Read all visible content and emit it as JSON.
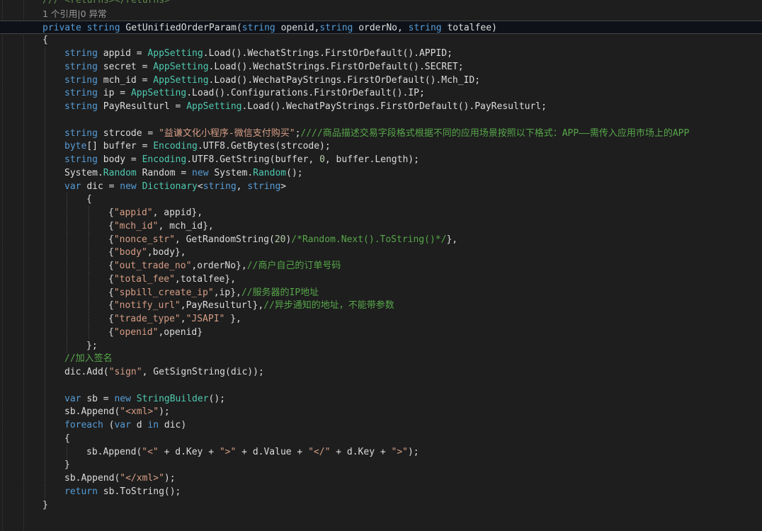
{
  "editor": {
    "language": "C#",
    "lines": [
      {
        "indent": 1,
        "tokens": [
          {
            "t": "doc",
            "v": "/// <returns></returns>"
          }
        ]
      },
      {
        "indent": 1,
        "ref": true,
        "tokens": [
          {
            "t": "ref",
            "v": "1 个引用|0 异常"
          }
        ]
      },
      {
        "indent": 1,
        "highlight": true,
        "tokens": [
          {
            "t": "kw",
            "v": "private "
          },
          {
            "t": "kw",
            "v": "string "
          },
          {
            "t": "plain",
            "v": "GetUnifiedOrderParam"
          },
          {
            "t": "plain",
            "v": "("
          },
          {
            "t": "kw",
            "v": "string "
          },
          {
            "t": "plain",
            "v": "openid,"
          },
          {
            "t": "kw",
            "v": "string "
          },
          {
            "t": "plain",
            "v": "orderNo, "
          },
          {
            "t": "kw",
            "v": "string "
          },
          {
            "t": "plain",
            "v": "totalfee"
          },
          {
            "t": "plain",
            "v": ")"
          }
        ]
      },
      {
        "indent": 1,
        "tokens": [
          {
            "t": "plain",
            "v": "{"
          }
        ]
      },
      {
        "indent": 2,
        "tokens": [
          {
            "t": "kw",
            "v": "string "
          },
          {
            "t": "plain",
            "v": "appid = "
          },
          {
            "t": "type",
            "v": "AppSetting"
          },
          {
            "t": "plain",
            "v": ".Load().WechatStrings.FirstOrDefault().APPID;"
          }
        ]
      },
      {
        "indent": 2,
        "tokens": [
          {
            "t": "kw",
            "v": "string "
          },
          {
            "t": "plain",
            "v": "secret = "
          },
          {
            "t": "type",
            "v": "AppSetting"
          },
          {
            "t": "plain",
            "v": ".Load().WechatStrings.FirstOrDefault().SECRET;"
          }
        ]
      },
      {
        "indent": 2,
        "tokens": [
          {
            "t": "kw",
            "v": "string "
          },
          {
            "t": "plain",
            "v": "mch_id = "
          },
          {
            "t": "type",
            "v": "AppSetting"
          },
          {
            "t": "plain",
            "v": ".Load().WechatPayStrings.FirstOrDefault().Mch_ID;"
          }
        ]
      },
      {
        "indent": 2,
        "tokens": [
          {
            "t": "kw",
            "v": "string "
          },
          {
            "t": "plain",
            "v": "ip = "
          },
          {
            "t": "type",
            "v": "AppSetting"
          },
          {
            "t": "plain",
            "v": ".Load().Configurations.FirstOrDefault().IP;"
          }
        ]
      },
      {
        "indent": 2,
        "tokens": [
          {
            "t": "kw",
            "v": "string "
          },
          {
            "t": "plain",
            "v": "PayResulturl = "
          },
          {
            "t": "type",
            "v": "AppSetting"
          },
          {
            "t": "plain",
            "v": ".Load().WechatPayStrings.FirstOrDefault().PayResulturl;"
          }
        ]
      },
      {
        "indent": 2,
        "tokens": []
      },
      {
        "indent": 2,
        "tokens": [
          {
            "t": "kw",
            "v": "string "
          },
          {
            "t": "plain",
            "v": "strcode = "
          },
          {
            "t": "str",
            "v": "\"益谦文化小程序-微信支付购买\""
          },
          {
            "t": "plain",
            "v": ";"
          },
          {
            "t": "com",
            "v": "////商品描述交易字段格式根据不同的应用场景按照以下格式：APP——需传入应用市场上的APP"
          }
        ]
      },
      {
        "indent": 2,
        "tokens": [
          {
            "t": "kw",
            "v": "byte"
          },
          {
            "t": "plain",
            "v": "[] buffer = "
          },
          {
            "t": "type",
            "v": "Encoding"
          },
          {
            "t": "plain",
            "v": ".UTF8.GetBytes(strcode);"
          }
        ]
      },
      {
        "indent": 2,
        "tokens": [
          {
            "t": "kw",
            "v": "string "
          },
          {
            "t": "plain",
            "v": "body = "
          },
          {
            "t": "type",
            "v": "Encoding"
          },
          {
            "t": "plain",
            "v": ".UTF8.GetString(buffer, "
          },
          {
            "t": "num",
            "v": "0"
          },
          {
            "t": "plain",
            "v": ", buffer.Length);"
          }
        ]
      },
      {
        "indent": 2,
        "tokens": [
          {
            "t": "plain",
            "v": "System."
          },
          {
            "t": "type",
            "v": "Random"
          },
          {
            "t": "plain",
            "v": " Random = "
          },
          {
            "t": "kw",
            "v": "new "
          },
          {
            "t": "plain",
            "v": "System."
          },
          {
            "t": "type",
            "v": "Random"
          },
          {
            "t": "plain",
            "v": "();"
          }
        ]
      },
      {
        "indent": 2,
        "tokens": [
          {
            "t": "kw",
            "v": "var "
          },
          {
            "t": "plain",
            "v": "dic = "
          },
          {
            "t": "kw",
            "v": "new "
          },
          {
            "t": "type",
            "v": "Dictionary"
          },
          {
            "t": "plain",
            "v": "<"
          },
          {
            "t": "kw",
            "v": "string"
          },
          {
            "t": "plain",
            "v": ", "
          },
          {
            "t": "kw",
            "v": "string"
          },
          {
            "t": "plain",
            "v": ">"
          }
        ]
      },
      {
        "indent": 3,
        "tokens": [
          {
            "t": "plain",
            "v": "{"
          }
        ]
      },
      {
        "indent": 4,
        "tokens": [
          {
            "t": "plain",
            "v": "{"
          },
          {
            "t": "str",
            "v": "\"appid\""
          },
          {
            "t": "plain",
            "v": ", appid},"
          }
        ]
      },
      {
        "indent": 4,
        "tokens": [
          {
            "t": "plain",
            "v": "{"
          },
          {
            "t": "str",
            "v": "\"mch_id\""
          },
          {
            "t": "plain",
            "v": ", mch_id},"
          }
        ]
      },
      {
        "indent": 4,
        "tokens": [
          {
            "t": "plain",
            "v": "{"
          },
          {
            "t": "str",
            "v": "\"nonce_str\""
          },
          {
            "t": "plain",
            "v": ", GetRandomString("
          },
          {
            "t": "num",
            "v": "20"
          },
          {
            "t": "plain",
            "v": ")"
          },
          {
            "t": "com",
            "v": "/*Random.Next().ToString()*/"
          },
          {
            "t": "plain",
            "v": "},"
          }
        ]
      },
      {
        "indent": 4,
        "tokens": [
          {
            "t": "plain",
            "v": "{"
          },
          {
            "t": "str",
            "v": "\"body\""
          },
          {
            "t": "plain",
            "v": ",body},"
          }
        ]
      },
      {
        "indent": 4,
        "tokens": [
          {
            "t": "plain",
            "v": "{"
          },
          {
            "t": "str",
            "v": "\"out_trade_no\""
          },
          {
            "t": "plain",
            "v": ",orderNo},"
          },
          {
            "t": "com",
            "v": "//商户自己的订单号码"
          }
        ]
      },
      {
        "indent": 4,
        "tokens": [
          {
            "t": "plain",
            "v": "{"
          },
          {
            "t": "str",
            "v": "\"total_fee\""
          },
          {
            "t": "plain",
            "v": ",totalfee},"
          }
        ]
      },
      {
        "indent": 4,
        "tokens": [
          {
            "t": "plain",
            "v": "{"
          },
          {
            "t": "str",
            "v": "\"spbill_create_ip\""
          },
          {
            "t": "plain",
            "v": ",ip},"
          },
          {
            "t": "com",
            "v": "//服务器的IP地址"
          }
        ]
      },
      {
        "indent": 4,
        "tokens": [
          {
            "t": "plain",
            "v": "{"
          },
          {
            "t": "str",
            "v": "\"notify_url\""
          },
          {
            "t": "plain",
            "v": ",PayResulturl},"
          },
          {
            "t": "com",
            "v": "//异步通知的地址，不能带参数"
          }
        ]
      },
      {
        "indent": 4,
        "tokens": [
          {
            "t": "plain",
            "v": "{"
          },
          {
            "t": "str",
            "v": "\"trade_type\""
          },
          {
            "t": "plain",
            "v": ","
          },
          {
            "t": "str",
            "v": "\"JSAPI\""
          },
          {
            "t": "plain",
            "v": " },"
          }
        ]
      },
      {
        "indent": 4,
        "tokens": [
          {
            "t": "plain",
            "v": "{"
          },
          {
            "t": "str",
            "v": "\"openid\""
          },
          {
            "t": "plain",
            "v": ",openid}"
          }
        ]
      },
      {
        "indent": 3,
        "tokens": [
          {
            "t": "plain",
            "v": "};"
          }
        ]
      },
      {
        "indent": 2,
        "tokens": [
          {
            "t": "com",
            "v": "//加入签名"
          }
        ]
      },
      {
        "indent": 2,
        "tokens": [
          {
            "t": "plain",
            "v": "dic.Add("
          },
          {
            "t": "str",
            "v": "\"sign\""
          },
          {
            "t": "plain",
            "v": ", GetSignString(dic));"
          }
        ]
      },
      {
        "indent": 2,
        "tokens": []
      },
      {
        "indent": 2,
        "tokens": [
          {
            "t": "kw",
            "v": "var "
          },
          {
            "t": "plain",
            "v": "sb = "
          },
          {
            "t": "kw",
            "v": "new "
          },
          {
            "t": "type",
            "v": "StringBuilder"
          },
          {
            "t": "plain",
            "v": "();"
          }
        ]
      },
      {
        "indent": 2,
        "tokens": [
          {
            "t": "plain",
            "v": "sb.Append("
          },
          {
            "t": "str",
            "v": "\"<xml>\""
          },
          {
            "t": "plain",
            "v": ");"
          }
        ]
      },
      {
        "indent": 2,
        "tokens": [
          {
            "t": "kw",
            "v": "foreach "
          },
          {
            "t": "plain",
            "v": "("
          },
          {
            "t": "kw",
            "v": "var "
          },
          {
            "t": "plain",
            "v": "d "
          },
          {
            "t": "kw",
            "v": "in "
          },
          {
            "t": "plain",
            "v": "dic)"
          }
        ]
      },
      {
        "indent": 2,
        "tokens": [
          {
            "t": "plain",
            "v": "{"
          }
        ]
      },
      {
        "indent": 3,
        "tokens": [
          {
            "t": "plain",
            "v": "sb.Append("
          },
          {
            "t": "str",
            "v": "\"<\""
          },
          {
            "t": "plain",
            "v": " + d.Key + "
          },
          {
            "t": "str",
            "v": "\">\""
          },
          {
            "t": "plain",
            "v": " + d.Value + "
          },
          {
            "t": "str",
            "v": "\"</\""
          },
          {
            "t": "plain",
            "v": " + d.Key + "
          },
          {
            "t": "str",
            "v": "\">\""
          },
          {
            "t": "plain",
            "v": ");"
          }
        ]
      },
      {
        "indent": 2,
        "tokens": [
          {
            "t": "plain",
            "v": "}"
          }
        ]
      },
      {
        "indent": 2,
        "tokens": [
          {
            "t": "plain",
            "v": "sb.Append("
          },
          {
            "t": "str",
            "v": "\"</xml>\""
          },
          {
            "t": "plain",
            "v": ");"
          }
        ]
      },
      {
        "indent": 2,
        "tokens": [
          {
            "t": "kw",
            "v": "return "
          },
          {
            "t": "plain",
            "v": "sb.ToString();"
          }
        ]
      },
      {
        "indent": 1,
        "tokens": [
          {
            "t": "plain",
            "v": "}"
          }
        ]
      }
    ]
  },
  "colors": {
    "background": "#1e1e1e",
    "keyword": "#569cd6",
    "type": "#4ec9b0",
    "string": "#d69d85",
    "comment": "#57a64a",
    "number": "#b5cea8",
    "plain": "#dcdcdc"
  }
}
